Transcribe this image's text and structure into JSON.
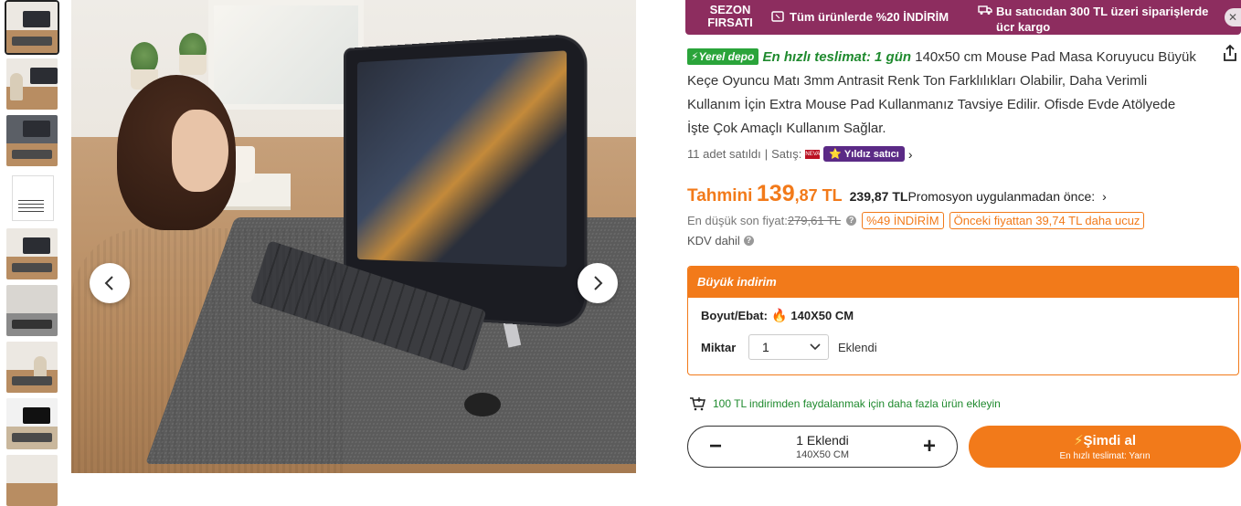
{
  "thumbnails": [
    {
      "kind": "desk"
    },
    {
      "kind": "person"
    },
    {
      "kind": "desk"
    },
    {
      "kind": "paper"
    },
    {
      "kind": "desk"
    },
    {
      "kind": "desk"
    },
    {
      "kind": "desk"
    },
    {
      "kind": "desk"
    }
  ],
  "gallery": {
    "prev_icon": "chevron-left-icon",
    "next_icon": "chevron-right-icon"
  },
  "promo_bar": {
    "label_line1": "SEZON",
    "label_line2": "FIRSATI",
    "item1": "Tüm ürünlerde %20 İNDİRİM",
    "item2": "Bu satıcıdan 300 TL üzeri siparişlerde ücr kargo",
    "close": "✕",
    "color": "#8d2d5f"
  },
  "product": {
    "depot_badge": "Yerel depo",
    "fast_delivery": "En hızlı teslimat: 1 gün",
    "title": "140x50 cm Mouse Pad Masa Koruyucu Büyük Keçe Oyuncu Matı 3mm Antrasit Renk Ton Farklılıkları Olabilir, Daha Verimli Kullanım İçin Extra Mouse Pad Kullanmanız Tavsiye Edilir. Ofisde Evde Atölyede İşte Çok Amaçlı Kullanım Sağlar.",
    "sold": "11 adet satıldı",
    "separator": "|",
    "seller_label": "Satış:",
    "seller_logo": "NEVA",
    "seller_badge": "Yıldız satıcı"
  },
  "price": {
    "tahmini": "Tahmini",
    "main": "139",
    "decimals": ",87 TL",
    "before_promo": "239,87 TL",
    "before_promo_label": "Promosyon uygulanmadan önce:",
    "lowest_label": "En düşük son fiyat:",
    "lowest_value": "279,61 TL",
    "discount_tag": "%49 İNDİRİM",
    "cheaper_tag": "Önceki fiyattan 39,74 TL daha ucuz",
    "kdv": "KDV dahil",
    "accent": "#f27a1a"
  },
  "deal": {
    "header": "Büyük indirim",
    "size_label": "Boyut/Ebat:",
    "size_value": "140X50 CM",
    "qty_label": "Miktar",
    "qty_value": "1",
    "qty_status": "Eklendi"
  },
  "cart_note": "100 TL indirimden faydalanmak için daha fazla ürün ekleyin",
  "stepper": {
    "minus": "−",
    "plus": "+",
    "main": "1 Eklendi",
    "sub": "140X50 CM"
  },
  "buy": {
    "label": "Şimdi al",
    "sub": "En hızlı teslimat: Yarın"
  }
}
